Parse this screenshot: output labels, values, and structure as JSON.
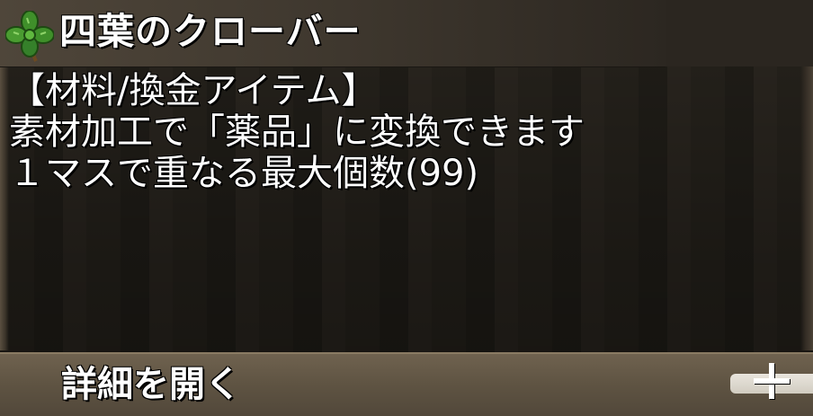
{
  "item": {
    "name": "四葉のクローバー",
    "icon": "four-leaf-clover-icon"
  },
  "description": {
    "lines": [
      "【材料/換金アイテム】",
      "素材加工で「薬品」に変換できます",
      "１マスで重なる最大個数(99)"
    ]
  },
  "footer": {
    "open_details_label": "詳細を開く",
    "expand_icon": "plus-icon"
  },
  "colors": {
    "text": "#ffffff",
    "panel": "#27231d",
    "title_bar": "#4f463a",
    "footer_bar": "#6f624f"
  }
}
